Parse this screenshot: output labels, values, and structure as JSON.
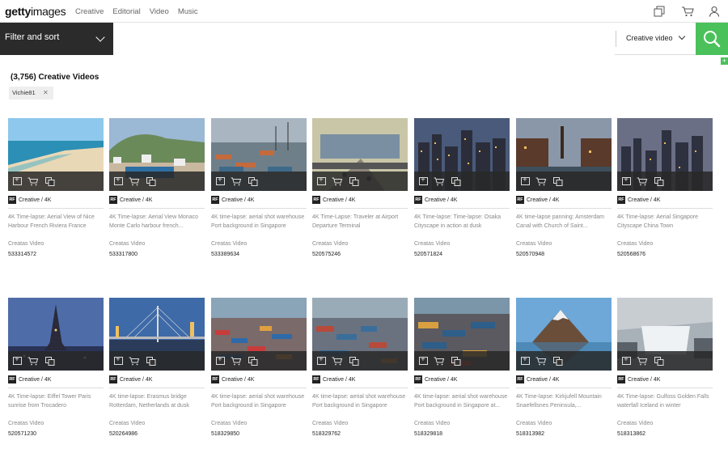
{
  "nav": {
    "logo_bold": "getty",
    "logo_light": "images",
    "links": [
      "Creative",
      "Editorial",
      "Video",
      "Music"
    ]
  },
  "search": {
    "filter_label": "Filter and sort",
    "placeholder": "",
    "type_label": "Creative video"
  },
  "results": {
    "count_label": "(3,756) Creative Videos",
    "chip": "Vichie81"
  },
  "colors": {
    "accent": "#4ac15b",
    "dark": "#2b2b2b"
  },
  "cards": [
    {
      "license": "Creative / 4K",
      "title": "4K Time-lapse: Aerial View of Nice Harbour French Riviera France",
      "collection": "Creatas Video",
      "id": "533314572",
      "theme": "beach"
    },
    {
      "license": "Creative / 4K",
      "title": "4K Time-lapse: Aerial View Monaco Monte Carlo harbour french...",
      "collection": "Creatas Video",
      "id": "533317800",
      "theme": "harbour"
    },
    {
      "license": "Creative / 4K",
      "title": "4K time-lapse: aerial shot warehouse Port background in Singapore",
      "collection": "Creatas Video",
      "id": "533389634",
      "theme": "port"
    },
    {
      "license": "Creative / 4K",
      "title": "4K Time-Lapse: Traveler at Airport Departure Terminal",
      "collection": "Creatas Video",
      "id": "520575246",
      "theme": "airport"
    },
    {
      "license": "Creative / 4K",
      "title": "4K Time-lapse: Time-lapse: Osaka Cityscape in action at dusk",
      "collection": "Creatas Video",
      "id": "520571824",
      "theme": "city-dusk"
    },
    {
      "license": "Creative / 4K",
      "title": "4K time-lapse panning: Amsterdam Canal with Church of Saint...",
      "collection": "Creatas Video",
      "id": "520570948",
      "theme": "canal"
    },
    {
      "license": "Creative / 4K",
      "title": "4K Time-lapse: Aerial Singapore Cityscape China Town",
      "collection": "Creatas Video",
      "id": "520568676",
      "theme": "city-dusk2"
    },
    {
      "license": "Creative / 4K",
      "title": "4K Time-lapse: Eiffel Tower Paris sunrise from Trocadero",
      "collection": "Creatas Video",
      "id": "520571230",
      "theme": "eiffel"
    },
    {
      "license": "Creative / 4K",
      "title": "4K time-lapse: Erasmus bridge Rotterdam, Netherlands at dusk",
      "collection": "Creatas Video",
      "id": "520264986",
      "theme": "bridge"
    },
    {
      "license": "Creative / 4K",
      "title": "4K time-lapse: aerial shot warehouse Port background in Singapore",
      "collection": "Creatas Video",
      "id": "518329850",
      "theme": "port2"
    },
    {
      "license": "Creative / 4K",
      "title": "4K time-lapse: aerial shot warehouse Port background in Singapore",
      "collection": "Creatas Video",
      "id": "518329762",
      "theme": "port3"
    },
    {
      "license": "Creative / 4K",
      "title": "4K time-lapse: aerial shot warehouse Port background in Singapore at...",
      "collection": "Creatas Video",
      "id": "518329818",
      "theme": "port4"
    },
    {
      "license": "Creative / 4K",
      "title": "4K Time-lapse: Kirkjufell Mountain Snaefellsnes Peninsula,...",
      "collection": "Creatas Video",
      "id": "518313982",
      "theme": "mountain"
    },
    {
      "license": "Creative / 4K",
      "title": "4K Time-lapse: Gulfoss Golden Falls waterfall Iceland in winter",
      "collection": "Creatas Video",
      "id": "518313862",
      "theme": "waterfall"
    }
  ]
}
